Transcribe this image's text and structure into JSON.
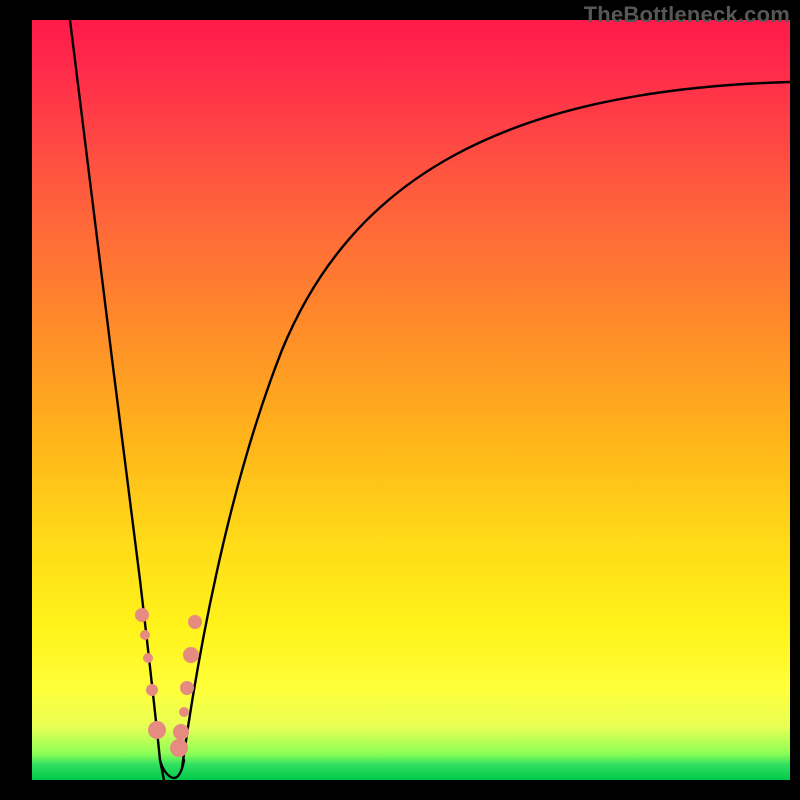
{
  "watermark": "TheBottleneck.com",
  "chart_data": {
    "type": "line",
    "title": "",
    "xlabel": "",
    "ylabel": "",
    "xlim": [
      0,
      100
    ],
    "ylim": [
      0,
      100
    ],
    "grid": false,
    "legend": false,
    "series": [
      {
        "name": "left-branch",
        "x": [
          5,
          7,
          9,
          11,
          13,
          14,
          15,
          16,
          16.5
        ],
        "values": [
          100,
          82,
          64,
          46,
          28,
          18,
          10,
          4,
          0
        ]
      },
      {
        "name": "right-branch",
        "x": [
          18,
          20,
          23,
          27,
          32,
          40,
          50,
          62,
          78,
          100
        ],
        "values": [
          0,
          12,
          28,
          45,
          58,
          70,
          79,
          85,
          89,
          92
        ]
      }
    ],
    "dots_left": {
      "x": [
        14.0,
        14.4,
        14.8,
        15.2,
        15.7
      ],
      "y": [
        22,
        19,
        16,
        11,
        6
      ],
      "size": [
        7,
        5,
        5,
        6,
        9
      ]
    },
    "dots_right": {
      "x": [
        18.3,
        18.5,
        18.8,
        19.0,
        19.3,
        19.7
      ],
      "y": [
        4,
        6,
        9,
        13,
        18,
        22
      ],
      "size": [
        9,
        8,
        5,
        7,
        8,
        7
      ]
    },
    "background_gradient": {
      "top": "#ff1a4a",
      "mid": "#ffd918",
      "bottom": "#00c84a"
    }
  }
}
